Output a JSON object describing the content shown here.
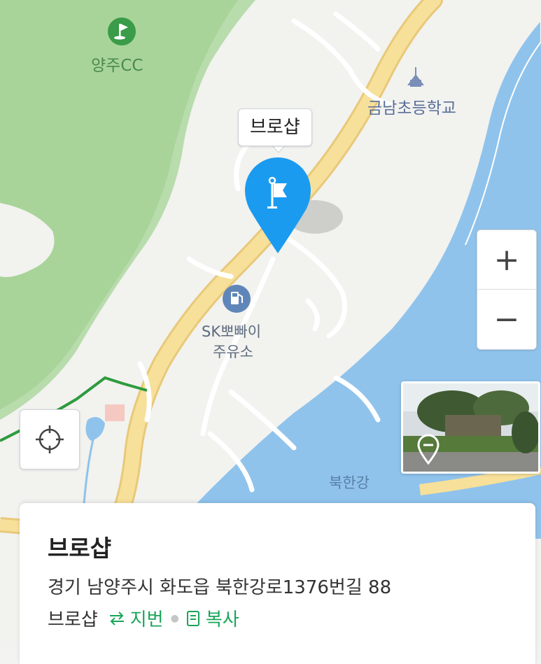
{
  "map": {
    "poi_golf": "양주CC",
    "poi_school": "금남초등학교",
    "poi_gas_line1": "SK뽀빠이",
    "poi_gas_line2": "주유소",
    "river_label": "북한강",
    "pin_label": "브로샵"
  },
  "controls": {
    "zoom_in": "+",
    "zoom_out": "−"
  },
  "place": {
    "name": "브로샵",
    "address": "경기 남양주시 화도읍 북한강로1376번길 88",
    "sub_name": "브로샵",
    "jibun_label": "지번",
    "copy_label": "복사"
  },
  "colors": {
    "pin": "#1a9bf0",
    "road": "#f6dc8a",
    "forest": "#a9d69c",
    "water": "#8fc3ec",
    "link": "#1aa55a"
  }
}
